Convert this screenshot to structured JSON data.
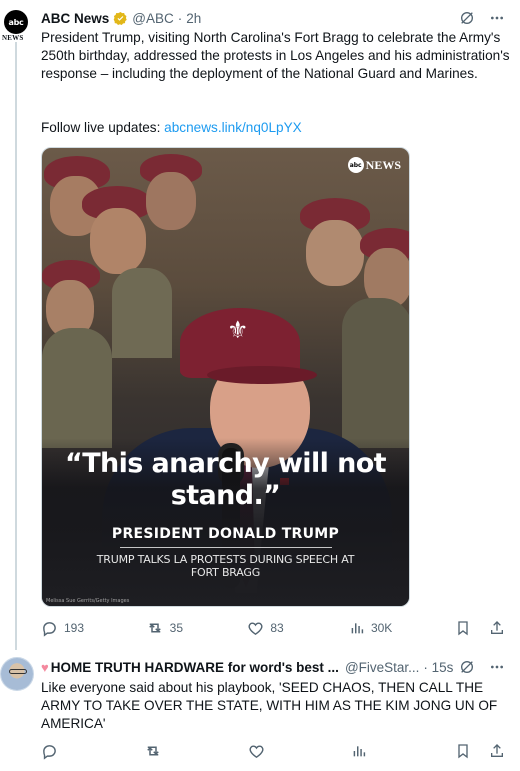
{
  "post1": {
    "author_name": "ABC News",
    "avatar_text": "abc",
    "avatar_label": "NEWS",
    "handle": "@ABC",
    "time": "2h",
    "text": "President Trump, visiting North Carolina's Fort Bragg to celebrate the Army's 250th birthday, addressed the protests in Los Angeles and his administration's response – including the deployment of the National Guard and Marines.",
    "follow_prefix": "Follow live updates: ",
    "follow_link": "abcnews.link/nq0LpYX",
    "media": {
      "badge_circle": "abc",
      "badge_text": "NEWS",
      "quote": "“This anarchy will not stand.”",
      "speaker": "PRESIDENT DONALD TRUMP",
      "subcaption": "TRUMP TALKS LA PROTESTS DURING SPEECH AT FORT BRAGG",
      "credit": "Melissa Sue Gerrits/Getty Images"
    },
    "stats": {
      "replies": "193",
      "reposts": "35",
      "likes": "83",
      "views": "30K"
    }
  },
  "post2": {
    "emoji": "♥",
    "author_name": "HOME TRUTH HARDWARE for word's best ...",
    "handle": "@FiveStar...",
    "time": "· 15s",
    "text": "Like everyone said about his playbook, 'SEED CHAOS, THEN CALL THE ARMY TO TAKE OVER THE STATE, WITH HIM AS THE KIM JONG UN OF AMERICA'"
  },
  "colors": {
    "accent": "#1d9bf0",
    "muted": "#536471",
    "verified_gold": "#e2b719",
    "divider": "#cfd9de"
  }
}
